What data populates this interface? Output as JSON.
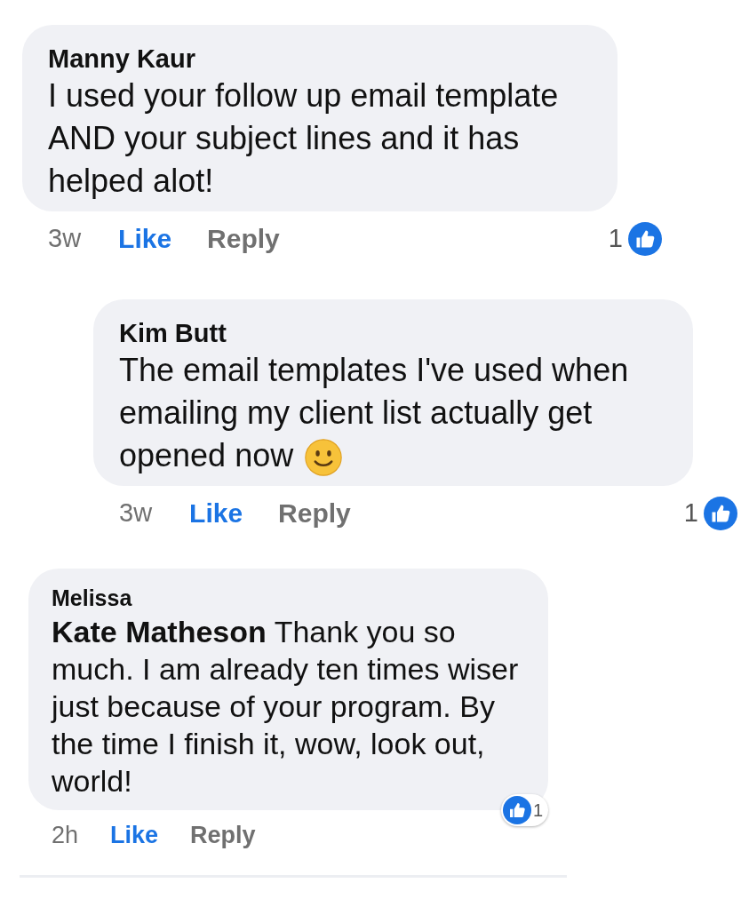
{
  "comments": [
    {
      "author": "Manny Kaur",
      "text": "I used your follow up email template AND your subject lines and it has helped alot!",
      "time": "3w",
      "like": "Like",
      "liked": true,
      "reply": "Reply",
      "reactions": {
        "kind": "inline",
        "count": "1"
      },
      "children": [
        {
          "author": "Kim Butt",
          "text": "The email templates I've used when emailing my client list actually get opened now",
          "time": "3w",
          "like": "Like",
          "liked": true,
          "reply": "Reply",
          "reactions": {
            "kind": "inline",
            "count": "1"
          },
          "emoji": true
        }
      ]
    },
    {
      "author": "Melissa",
      "text": "**Kate Matheson** Thank you so much. I am already ten times wiser just because of your program. By the time I finish it, wow, look out, world!",
      "time": "2h",
      "like": "Like",
      "liked": true,
      "reply": "Reply",
      "reactions": {
        "kind": "badge",
        "count": "1"
      },
      "compact": true
    }
  ]
}
